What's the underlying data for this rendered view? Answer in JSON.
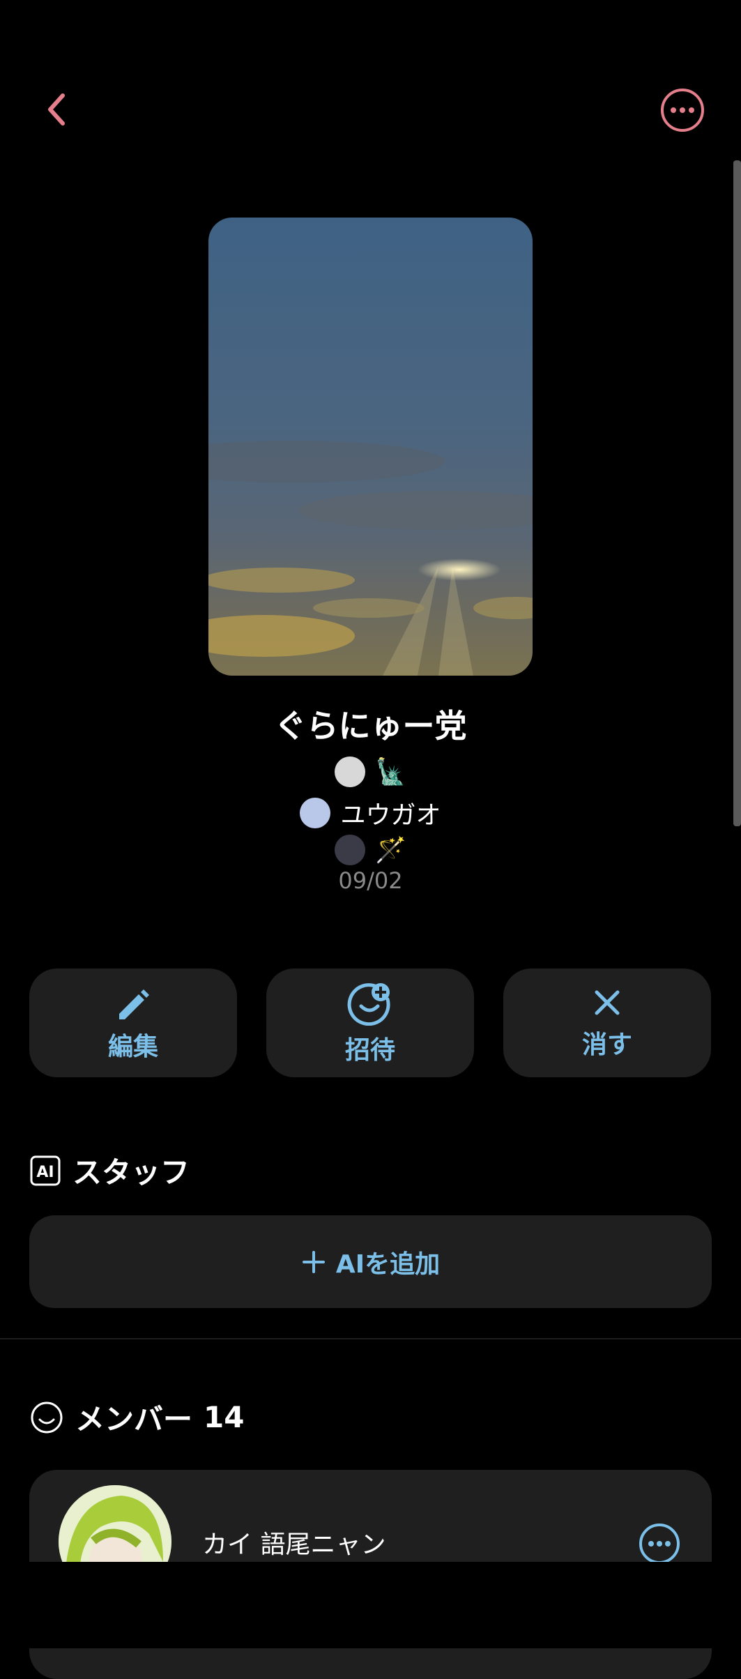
{
  "header": {
    "back_icon": "chevron-left-icon",
    "more_icon": "more-circle-icon",
    "accent": "#e57f8c"
  },
  "group": {
    "name": "ぐらにゅー党",
    "members_preview": [
      {
        "label": "🗽",
        "avatar_color": "#d8d8d8"
      },
      {
        "label": "ユウガオ",
        "avatar_color": "#b9c8e8"
      },
      {
        "label": "🪄",
        "avatar_color": "#3b3b48"
      }
    ],
    "date": "09/02"
  },
  "actions": [
    {
      "label": "編集",
      "icon": "pencil-icon"
    },
    {
      "label": "招待",
      "icon": "add-person-icon"
    },
    {
      "label": "消す",
      "icon": "close-icon"
    }
  ],
  "staff": {
    "heading": "スタッフ",
    "icon": "ai-badge-icon",
    "add_label": "AIを追加"
  },
  "members": {
    "heading": "メンバー",
    "count": "14",
    "items": [
      {
        "name": "カイ 語尾ニャン"
      }
    ]
  },
  "colors": {
    "button_bg": "#1f1f1f",
    "button_text": "#7cc0ea",
    "accent": "#e57f8c"
  }
}
